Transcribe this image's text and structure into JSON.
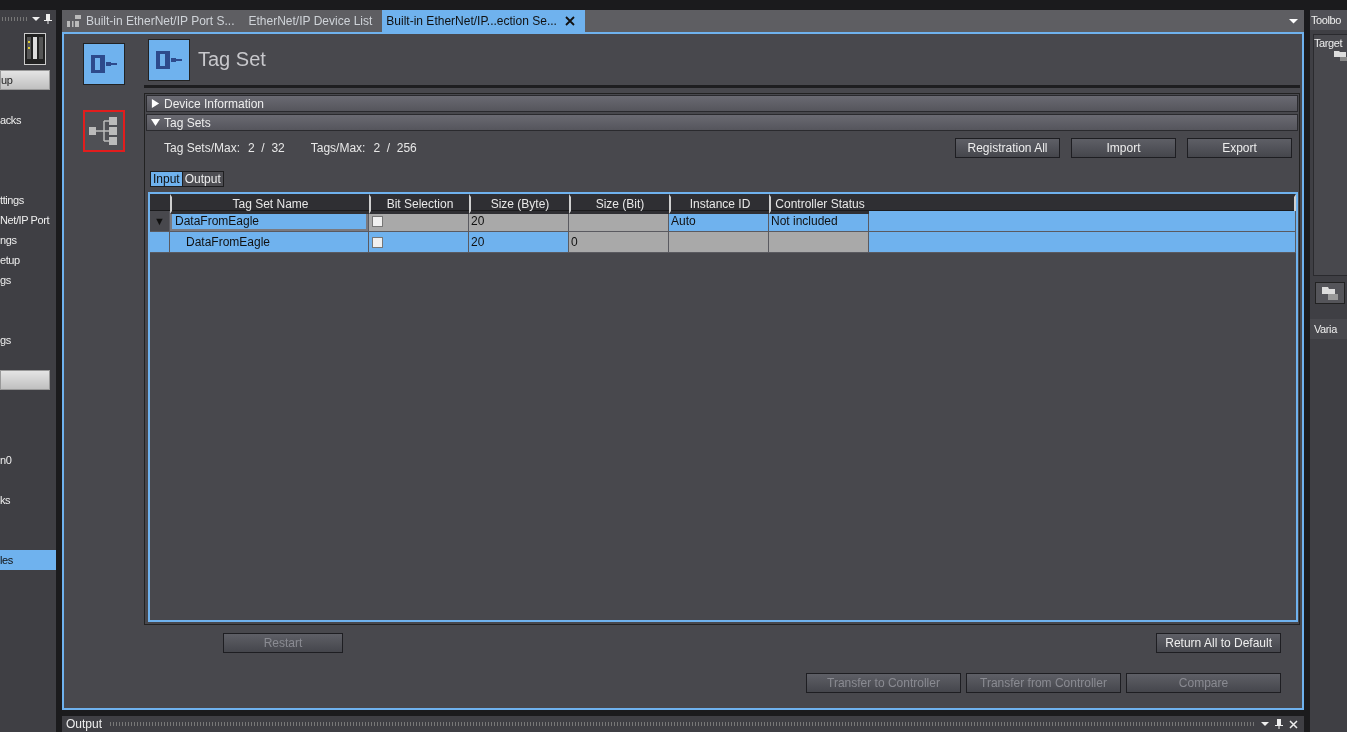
{
  "sidebar": {
    "items": [
      {
        "kind": "category",
        "label": "up"
      },
      {
        "kind": "item",
        "label": "acks",
        "selected": false
      },
      {
        "kind": "item",
        "label": "ttings",
        "selected": false
      },
      {
        "kind": "item",
        "label": "Net/IP Port",
        "selected": false
      },
      {
        "kind": "item",
        "label": "ngs",
        "selected": false
      },
      {
        "kind": "item",
        "label": "etup",
        "selected": false
      },
      {
        "kind": "item",
        "label": "gs",
        "selected": false
      },
      {
        "kind": "item",
        "label": "gs",
        "selected": false
      },
      {
        "kind": "category"
      },
      {
        "kind": "item",
        "label": "n0",
        "selected": false
      },
      {
        "kind": "item",
        "label": "ks",
        "selected": false
      },
      {
        "kind": "item",
        "label": "les",
        "selected": true
      }
    ]
  },
  "tabs": [
    {
      "label": "Built-in EtherNet/IP Port S...",
      "selected": false,
      "icon": true
    },
    {
      "label": "EtherNet/IP Device List",
      "selected": false
    },
    {
      "label": "Built-in EtherNet/IP...ection Se...",
      "selected": true,
      "closable": true
    }
  ],
  "page": {
    "title": "Tag Set"
  },
  "sections": [
    {
      "label": "Device Information",
      "expanded": false
    },
    {
      "label": "Tag Sets",
      "expanded": true
    }
  ],
  "stats": [
    {
      "label": "Tag Sets/Max:",
      "value": "2  /  32"
    },
    {
      "label": "Tags/Max:",
      "value": "2  /  256"
    }
  ],
  "top_buttons": [
    "Registration All",
    "Import",
    "Export"
  ],
  "subtabs": [
    {
      "label": "Input",
      "selected": true
    },
    {
      "label": "Output",
      "selected": false
    }
  ],
  "table": {
    "columns": [
      "Tag Set Name",
      "Bit Selection",
      "Size (Byte)",
      "Size (Bit)",
      "Instance ID",
      "Controller Status"
    ],
    "rows": [
      {
        "expander": "▼",
        "child": false,
        "editing": true,
        "cells": [
          {
            "text": "DataFromEagle",
            "readonly": false
          },
          {
            "checkbox": true,
            "checked": false,
            "readonly": true
          },
          {
            "text": "20",
            "readonly": true
          },
          {
            "readonly": true
          },
          {
            "text": "Auto",
            "readonly": false
          },
          {
            "text": "Not included",
            "readonly": false
          }
        ]
      },
      {
        "child": true,
        "editing": false,
        "cells": [
          {
            "text": "DataFromEagle",
            "readonly": false
          },
          {
            "checkbox": true,
            "checked": false,
            "readonly": false
          },
          {
            "text": "20",
            "readonly": false
          },
          {
            "text": "0",
            "readonly": true
          },
          {
            "readonly": true
          },
          {
            "readonly": true
          }
        ]
      }
    ]
  },
  "reset_buttons": [
    {
      "label": "Restart",
      "disabled": true
    },
    {
      "label": "Return All to Default",
      "disabled": false
    }
  ],
  "transfer_buttons": [
    {
      "label": "Transfer to Controller",
      "disabled": true
    },
    {
      "label": "Transfer from Controller",
      "disabled": true
    },
    {
      "label": "Compare",
      "disabled": true
    }
  ],
  "output_panel": {
    "title": "Output"
  },
  "right_panel": {
    "toolbox_title": "Toolbo",
    "target_label": "Target",
    "variables_title": "Varia"
  }
}
